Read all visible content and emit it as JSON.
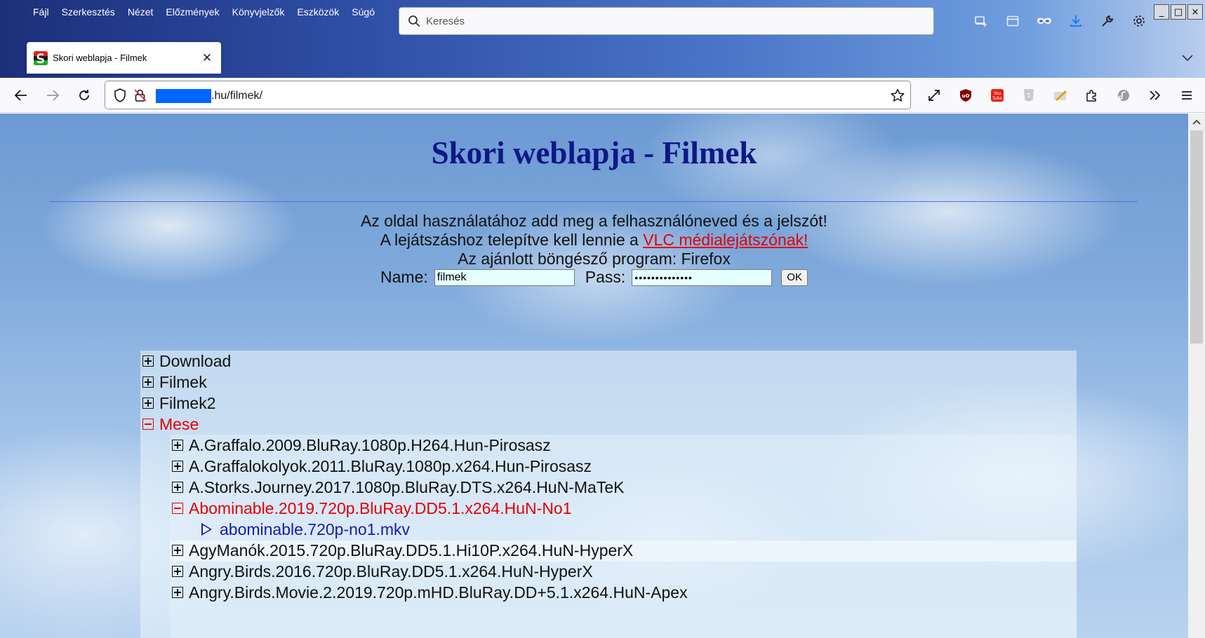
{
  "menubar": [
    "Fájl",
    "Szerkesztés",
    "Nézet",
    "Előzmények",
    "Könyvjelzők",
    "Eszközök",
    "Súgó"
  ],
  "search": {
    "placeholder": "Keresés"
  },
  "tab": {
    "title": "Skori weblapja - Filmek"
  },
  "urlbar": {
    "url": ".hu/filmek/"
  },
  "page": {
    "title": "Skori weblapja - Filmek",
    "intro_line1": "Az oldal használatához add meg a felhasználóneved és a jelszót!",
    "intro_line2_prefix": "A lejátszáshoz telepítve kell lennie a",
    "intro_line2_link": "VLC médialejátszónak!",
    "intro_line3": "Az ajánlott böngésző program: Firefox",
    "login": {
      "name_label": "Name:",
      "name_value": "filmek",
      "pass_label": "Pass:",
      "pass_value": "••••••••••••••",
      "ok_label": "OK"
    }
  },
  "tree": {
    "top_items": [
      {
        "label": "Download",
        "state": "collapsed"
      },
      {
        "label": "Filmek",
        "state": "collapsed"
      },
      {
        "label": "Filmek2",
        "state": "collapsed"
      },
      {
        "label": "Mese",
        "state": "expanded"
      }
    ],
    "mese_children": [
      {
        "label": "A.Graffalo.2009.BluRay.1080p.H264.Hun-Pirosasz",
        "state": "collapsed"
      },
      {
        "label": "A.Graffalokolyok.2011.BluRay.1080p.x264.Hun-Pirosasz",
        "state": "collapsed"
      },
      {
        "label": "A.Storks.Journey.2017.1080p.BluRay.DTS.x264.HuN-MaTeK",
        "state": "collapsed"
      },
      {
        "label": "Abominable.2019.720p.BluRay.DD5.1.x264.HuN-No1",
        "state": "expanded"
      },
      {
        "label": "AgyManók.2015.720p.BluRay.DD5.1.Hi10P.x264.HuN-HyperX",
        "state": "collapsed"
      },
      {
        "label": "Angry.Birds.2016.720p.BluRay.DD5.1.x264.HuN-HyperX",
        "state": "collapsed"
      },
      {
        "label": "Angry.Birds.Movie.2.2019.720p.mHD.BluRay.DD+5.1.x264.HuN-Apex",
        "state": "collapsed"
      }
    ],
    "file": "abominable.720p-no1.mkv"
  },
  "colors": {
    "title": "#0e1787",
    "expanded_red": "#e30000",
    "file_blue": "#1a1aa8",
    "redaction": "#0066ff"
  }
}
